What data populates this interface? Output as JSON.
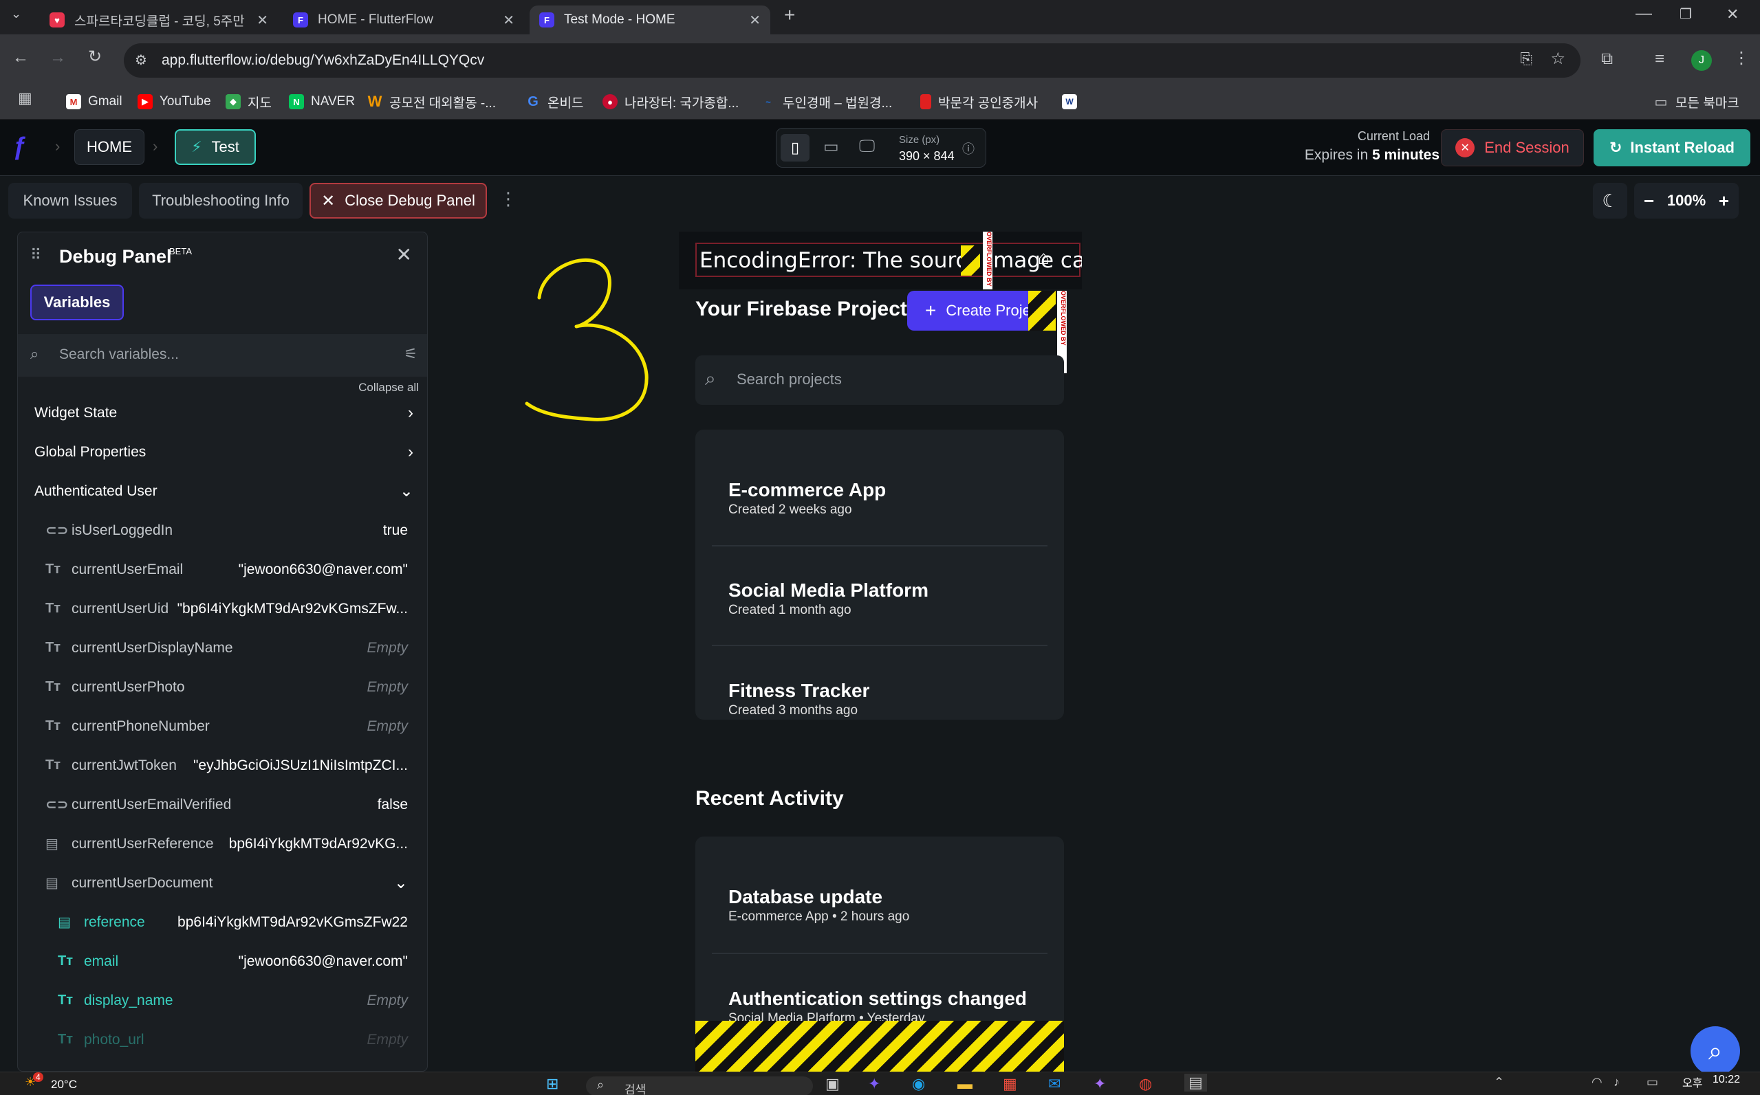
{
  "browser": {
    "tabs": [
      {
        "title": "스파르타코딩클럽 - 코딩, 5주만",
        "active": false
      },
      {
        "title": "HOME - FlutterFlow",
        "active": false
      },
      {
        "title": "Test Mode - HOME",
        "active": true
      }
    ],
    "url": "app.flutterflow.io/debug/Yw6xhZaDyEn4ILLQYQcv",
    "bookmarks": [
      "Gmail",
      "YouTube",
      "지도",
      "NAVER",
      "공모전 대외활동 -...",
      "온비드",
      "나라장터: 국가종합...",
      "두인경매 – 법원경...",
      "박문각 공인중개사"
    ],
    "all_bookmarks": "모든 북마크",
    "profile_initial": "J"
  },
  "header": {
    "page_name": "HOME",
    "mode": "Test",
    "size_label": "Size (px)",
    "size_value": "390 × 844",
    "load_label": "Current Load",
    "expires_prefix": "Expires in",
    "expires_value": "5 minutes",
    "end_session": "End Session",
    "instant_reload": "Instant Reload"
  },
  "subbar": {
    "known_issues": "Known Issues",
    "troubleshooting": "Troubleshooting Info",
    "close_debug": "Close Debug Panel",
    "zoom": "100%"
  },
  "debug_panel": {
    "title": "Debug Panel",
    "badge": "BETA",
    "tab": "Variables",
    "search_placeholder": "Search variables...",
    "collapse_all": "Collapse all",
    "sections": [
      "Widget State",
      "Global Properties",
      "Authenticated User"
    ],
    "variables": [
      {
        "name": "isUserLoggedIn",
        "value": "true",
        "type": "bool"
      },
      {
        "name": "currentUserEmail",
        "value": "\"jewoon6630@naver.com\"",
        "type": "text"
      },
      {
        "name": "currentUserUid",
        "value": "\"bp6I4iYkgkMT9dAr92vKGmsZFw...",
        "type": "text"
      },
      {
        "name": "currentUserDisplayName",
        "value": "Empty",
        "type": "text"
      },
      {
        "name": "currentUserPhoto",
        "value": "Empty",
        "type": "text"
      },
      {
        "name": "currentPhoneNumber",
        "value": "Empty",
        "type": "text"
      },
      {
        "name": "currentJwtToken",
        "value": "\"eyJhbGciOiJSUzI1NiIsImtpZCI...",
        "type": "text"
      },
      {
        "name": "currentUserEmailVerified",
        "value": "false",
        "type": "bool"
      },
      {
        "name": "currentUserReference",
        "value": "bp6I4iYkgkMT9dAr92vKG...",
        "type": "doc"
      },
      {
        "name": "currentUserDocument",
        "value": "",
        "type": "doc"
      }
    ],
    "document_fields": [
      {
        "name": "reference",
        "value": "bp6I4iYkgkMT9dAr92vKGmsZFw22",
        "type": "doc"
      },
      {
        "name": "email",
        "value": "\"jewoon6630@naver.com\"",
        "type": "text"
      },
      {
        "name": "display_name",
        "value": "Empty",
        "type": "text"
      },
      {
        "name": "photo_url",
        "value": "Empty",
        "type": "text"
      }
    ]
  },
  "preview": {
    "error_text": "EncodingError: The source image cannot",
    "projects_heading": "Your Firebase Projects",
    "create_button": "Create Project",
    "search_placeholder": "Search projects",
    "projects": [
      {
        "name": "E-commerce App",
        "created": "Created 2 weeks ago"
      },
      {
        "name": "Social Media Platform",
        "created": "Created 1 month ago"
      },
      {
        "name": "Fitness Tracker",
        "created": "Created 3 months ago"
      }
    ],
    "activity_heading": "Recent Activity",
    "activity": [
      {
        "title": "Database update",
        "meta": "E-commerce App • 2 hours ago"
      },
      {
        "title": "Authentication settings changed",
        "meta": "Social Media Platform • Yesterday"
      }
    ],
    "overflow_label": "OVERFLOWED BY"
  },
  "annotation": {
    "text": "3",
    "color": "#f5e400"
  },
  "taskbar": {
    "weather": "20°C",
    "weather_badge": "4",
    "search": "검색",
    "time_period": "오후",
    "time": "10:22"
  },
  "colors": {
    "accent": "#4b39ef",
    "teal": "#39d2c0",
    "danger": "#e0383e",
    "hazard": "#f5e400"
  }
}
